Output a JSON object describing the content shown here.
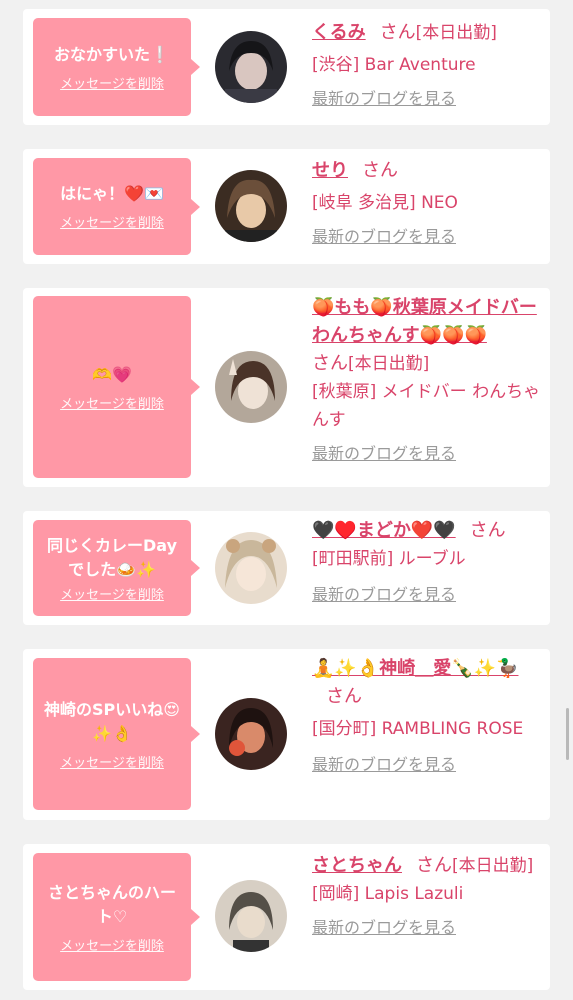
{
  "delete_label": "メッセージを削除",
  "blog_label": "最新のブログを見る",
  "san_label": "さん",
  "cards": [
    {
      "message": "おなかすいた❕",
      "name": "くるみ",
      "tag": "[本日出勤]",
      "shop": "[渋谷] Bar Aventure",
      "avatar_colors": [
        "#2a2a30",
        "#d9c6c0"
      ]
    },
    {
      "message": "はにゃ！❤️💌",
      "name": "せり",
      "tag": "",
      "shop": "[岐阜 多治見] NEO",
      "avatar_colors": [
        "#6b4f3a",
        "#e8c9a8"
      ]
    },
    {
      "message": "🫶💗",
      "name": "🍑もも🍑秋葉原メイドバーわんちゃんす🍑🍑🍑",
      "tag": "[本日出勤]",
      "shop": "[秋葉原] メイドバー わんちゃんす",
      "avatar_colors": [
        "#b3a79a",
        "#efe2d6"
      ]
    },
    {
      "message": "同じくカレーDayでした🍛✨",
      "name": "🖤♥️まどか❤️🖤",
      "tag": "",
      "shop": "[町田駅前] ルーブル",
      "avatar_colors": [
        "#c9b79b",
        "#f6e6d8"
      ]
    },
    {
      "message": "神崎のSPいいね😍✨👌",
      "name": "🧘✨👌神崎＿愛🍾✨🦆",
      "tag": "",
      "shop": "[国分町] RAMBLING ROSE",
      "avatar_colors": [
        "#3a2420",
        "#d98a6a"
      ]
    },
    {
      "message": "さとちゃんのハート♡",
      "name": "さとちゃん",
      "tag": "[本日出勤]",
      "shop": "[岡崎] Lapis Lazuli",
      "avatar_colors": [
        "#555048",
        "#d7cfc4"
      ]
    }
  ]
}
